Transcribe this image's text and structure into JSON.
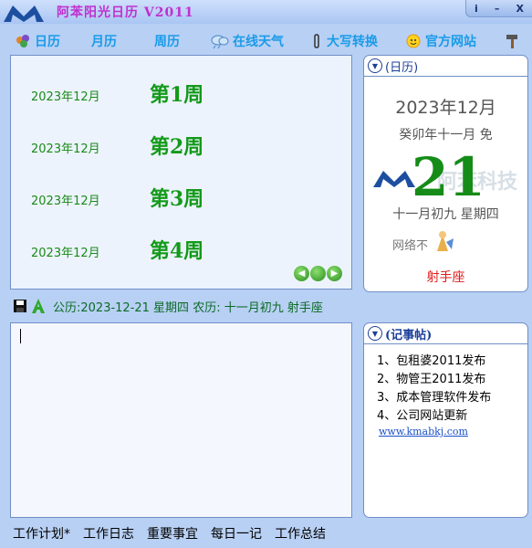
{
  "window": {
    "title": "阿苯阳光日历 V2011",
    "help_label": "i",
    "minimize_label": "–",
    "close_label": "X"
  },
  "toolbar": {
    "items": [
      {
        "label": "日历",
        "icon": "grapes-icon"
      },
      {
        "label": "月历"
      },
      {
        "label": "周历"
      },
      {
        "label": "在线天气",
        "icon": "weather-cloud-icon"
      },
      {
        "label": "大写转换",
        "icon": "paperclip-icon"
      },
      {
        "label": "官方网站",
        "icon": "smiley-sun-icon"
      },
      {
        "icon": "hammer-icon"
      }
    ]
  },
  "weeks": [
    {
      "date": "2023年12月",
      "label": "第1周"
    },
    {
      "date": "2023年12月",
      "label": "第2周"
    },
    {
      "date": "2023年12月",
      "label": "第3周"
    },
    {
      "date": "2023年12月",
      "label": "第4周"
    }
  ],
  "calendar": {
    "header": "(日历)",
    "year_month": "2023年12月",
    "lunar_year": "癸卯年十一月 免",
    "day": "21",
    "watermark": "阿苯科技",
    "lunar_date": "十一月初九 星期四",
    "network_status": "网络不",
    "zodiac": "射手座"
  },
  "status_line": "公历:2023-12-21 星期四 农历: 十一月初九 射手座",
  "memo": {
    "header": "(记事帖)",
    "items": [
      "1、包租婆2011发布",
      "2、物管王2011发布",
      "3、成本管理软件发布",
      "4、公司网站更新"
    ],
    "link": "www.kmabkj.com"
  },
  "tabs": [
    "工作计划*",
    "工作日志",
    "重要事宜",
    "每日一记",
    "工作总结"
  ],
  "colors": {
    "background": "#b8d0f4",
    "accent_green": "#139a19",
    "toolbar_blue": "#1a9be8",
    "title_magenta": "#c030d0",
    "zodiac_red": "#e21919"
  }
}
